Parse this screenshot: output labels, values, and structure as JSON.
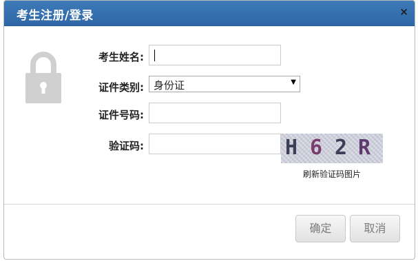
{
  "dialog": {
    "title": "考生注册/登录",
    "close_label": "×"
  },
  "form": {
    "name_label": "考生姓名:",
    "name_value": "",
    "id_type_label": "证件类别:",
    "id_type_value": "身份证",
    "id_number_label": "证件号码:",
    "id_number_value": "",
    "captcha_label": "验证码:",
    "captcha_value": "",
    "captcha_chars": [
      "H",
      "6",
      "2",
      "R"
    ],
    "captcha_char_colors": [
      "#3c3f57",
      "#7a3e6c",
      "#3c3f57",
      "#5e3a6f"
    ],
    "refresh_label": "刷新验证码图片"
  },
  "footer": {
    "confirm_label": "确定",
    "cancel_label": "取消"
  },
  "colors": {
    "header_bg": "#2e67a6",
    "lock_icon": "#d0d0d0"
  },
  "icons": {
    "lock": "lock-icon",
    "close": "close-icon",
    "dropdown": "chevron-down-icon"
  }
}
